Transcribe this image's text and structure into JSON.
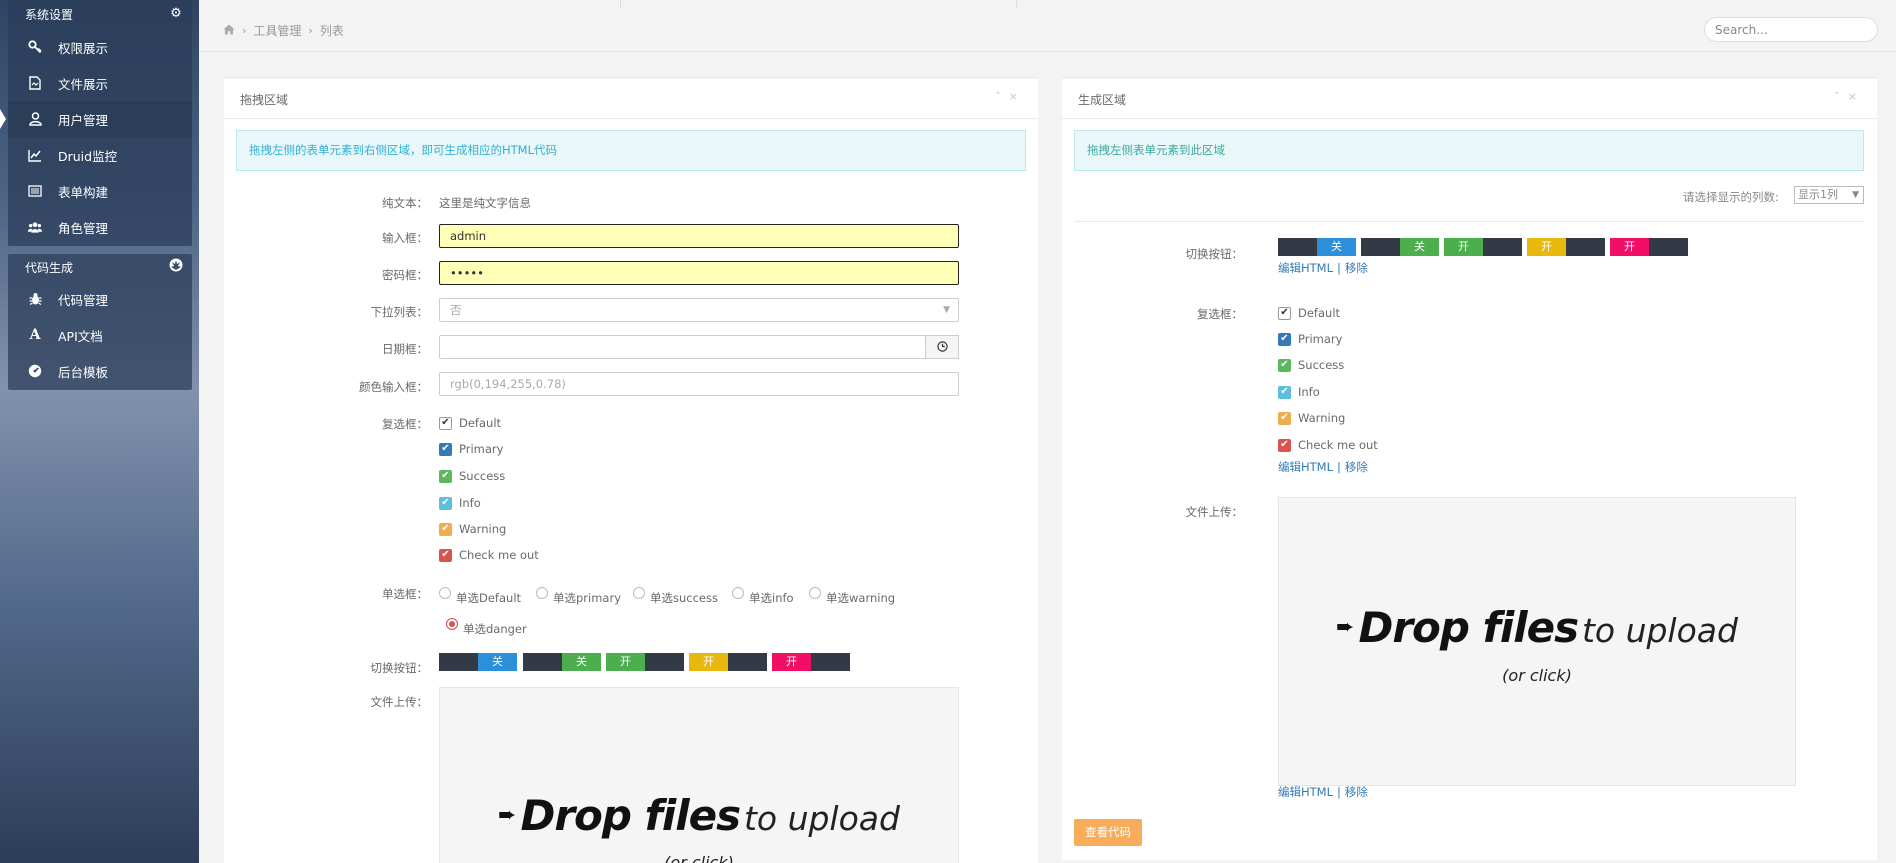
{
  "colors": {
    "primary": "#337ab7",
    "success": "#5cb85c",
    "info": "#5bc0de",
    "warning": "#f0ad4e",
    "danger": "#d9534f",
    "toggle_blue": "#2d8fd9",
    "toggle_green": "#4cae4c",
    "toggle_yellow": "#e8b80e",
    "toggle_pink": "#f00f64",
    "toggle_dark": "#333a45"
  },
  "sidebar": {
    "group1": {
      "title": "系统设置",
      "icon": "gear-icon",
      "items": [
        {
          "label": "权限展示",
          "icon": "key-icon"
        },
        {
          "label": "文件展示",
          "icon": "file-icon"
        },
        {
          "label": "用户管理",
          "icon": "user-icon",
          "active": true
        },
        {
          "label": "Druid监控",
          "icon": "line-chart-icon"
        },
        {
          "label": "表单构建",
          "icon": "list-icon"
        },
        {
          "label": "角色管理",
          "icon": "users-icon"
        }
      ]
    },
    "group2": {
      "title": "代码生成",
      "icon": "rebel-icon",
      "items": [
        {
          "label": "代码管理",
          "icon": "bug-icon"
        },
        {
          "label": "API文档",
          "icon": "font-icon"
        },
        {
          "label": "后台模板",
          "icon": "dashboard-icon"
        }
      ]
    }
  },
  "topbar": {
    "breadcrumb": [
      "工具管理",
      "列表"
    ],
    "search_placeholder": "Search..."
  },
  "left_panel": {
    "title": "拖拽区域",
    "alert": "拖拽左侧的表单元素到右侧区域，即可生成相应的HTML代码",
    "plain_text": {
      "label": "纯文本：",
      "value": "这里是纯文字信息"
    },
    "input": {
      "label": "输入框：",
      "value": "admin"
    },
    "password": {
      "label": "密码框：",
      "value": "•••••"
    },
    "select": {
      "label": "下拉列表：",
      "value": "否"
    },
    "date": {
      "label": "日期框：",
      "value": ""
    },
    "color": {
      "label": "颜色输入框：",
      "placeholder": "rgb(0,194,255,0.78)"
    },
    "checkbox": {
      "label": "复选框：",
      "items": [
        "Default",
        "Primary",
        "Success",
        "Info",
        "Warning",
        "Check me out"
      ]
    },
    "radio": {
      "label": "单选框：",
      "items": [
        "单选Default",
        "单选primary",
        "单选success",
        "单选info",
        "单选warning",
        "单选danger"
      ],
      "selected": "单选danger"
    },
    "toggle": {
      "label": "切换按钮：",
      "items": [
        {
          "text": "关",
          "state": "off",
          "color": "blue"
        },
        {
          "text": "关",
          "state": "off",
          "color": "green"
        },
        {
          "text": "开",
          "state": "on",
          "color": "green"
        },
        {
          "text": "开",
          "state": "on",
          "color": "yellow"
        },
        {
          "text": "开",
          "state": "on",
          "color": "pink"
        }
      ]
    },
    "upload": {
      "label": "文件上传：",
      "drop_bold": "Drop files",
      "drop_light": "to upload",
      "drop_sub": "(or click)"
    }
  },
  "right_panel": {
    "title": "生成区域",
    "alert": "拖拽左侧表单元素到此区域",
    "columns_label": "请选择显示的列数:",
    "columns_value": "显示1列",
    "toggle": {
      "label": "切换按钮：",
      "items": [
        {
          "text": "关",
          "state": "off",
          "color": "blue"
        },
        {
          "text": "关",
          "state": "off",
          "color": "green"
        },
        {
          "text": "开",
          "state": "on",
          "color": "green"
        },
        {
          "text": "开",
          "state": "on",
          "color": "yellow"
        },
        {
          "text": "开",
          "state": "on",
          "color": "pink"
        }
      ]
    },
    "checkbox": {
      "label": "复选框：",
      "items": [
        "Default",
        "Primary",
        "Success",
        "Info",
        "Warning",
        "Check me out"
      ]
    },
    "upload": {
      "label": "文件上传：",
      "drop_bold": "Drop files",
      "drop_light": "to upload",
      "drop_sub": "(or click)"
    },
    "edit_html": "编辑HTML",
    "remove": "移除",
    "separator": "|",
    "view_code_button": "查看代码"
  }
}
